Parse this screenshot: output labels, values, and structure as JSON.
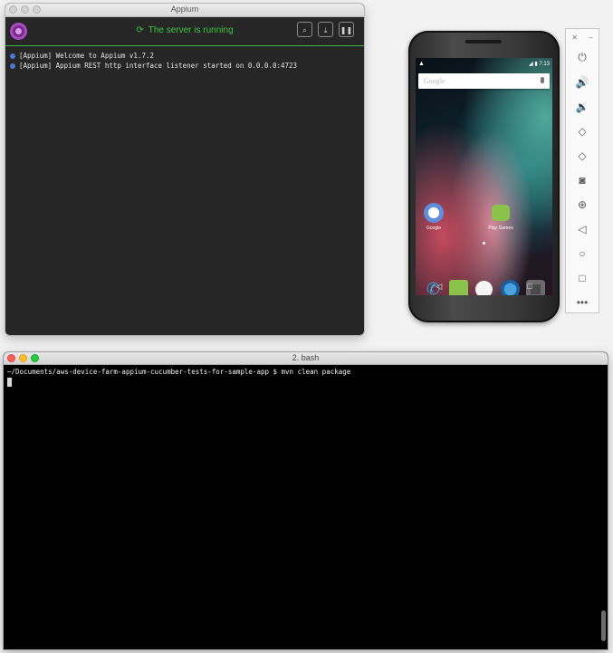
{
  "appium": {
    "window_title": "Appium",
    "server_status": "The server is running",
    "toolbar_icons": [
      "search-icon",
      "download-icon",
      "pause-icon"
    ],
    "log": [
      "[Appium] Welcome to Appium v1.7.2",
      "[Appium] Appium REST http interface listener started on 0.0.0.0:4723"
    ]
  },
  "android": {
    "status_time": "7:13",
    "search_placeholder": "Google",
    "apps": [
      {
        "label": "Google",
        "icon": "google-folder-icon"
      },
      {
        "label": "Play Games",
        "icon": "play-games-icon"
      }
    ],
    "dock_icons": [
      "phone-icon",
      "messages-icon",
      "app-drawer-icon",
      "browser-icon",
      "camera-icon"
    ],
    "nav_icons": [
      "back-icon",
      "home-icon",
      "recents-icon"
    ]
  },
  "emulator_controls": {
    "window_buttons": [
      "close-icon",
      "minimize-icon"
    ],
    "buttons": [
      "power-icon",
      "volume-up-icon",
      "volume-down-icon",
      "rotate-left-icon",
      "rotate-right-icon",
      "camera-icon",
      "zoom-icon",
      "back-icon",
      "home-icon",
      "overview-icon",
      "more-icon"
    ]
  },
  "terminal": {
    "window_title": "2. bash",
    "prompt_line": "~/Documents/aws-device-farm-appium-cucumber-tests-for-sample-app $ mvn clean package"
  },
  "colors": {
    "server_running": "#3bc53d",
    "appium_bg": "#262626",
    "terminal_bg": "#000000"
  }
}
